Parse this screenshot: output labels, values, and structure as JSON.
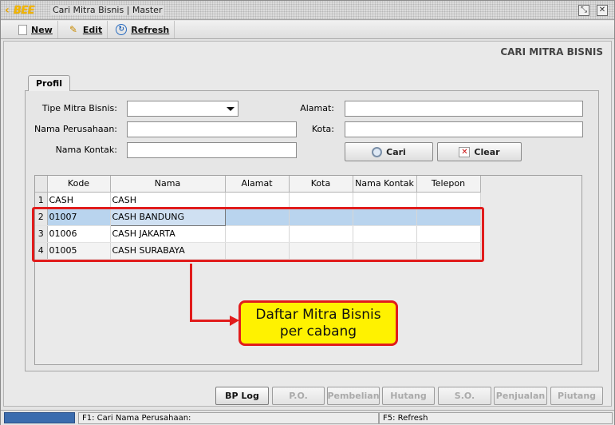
{
  "window": {
    "logo_text": "BEE",
    "title": "Cari Mitra Bisnis | Master",
    "buttons": [
      "restore-icon",
      "close-icon"
    ]
  },
  "toolbar": {
    "new_label": "New",
    "edit_label": "Edit",
    "refresh_label": "Refresh"
  },
  "page_title": "CARI MITRA BISNIS",
  "tab_label": "Profil",
  "form": {
    "tipe_label": "Tipe Mitra Bisnis:",
    "tipe_value": "",
    "nama_perusahaan_label": "Nama Perusahaan:",
    "nama_perusahaan_value": "",
    "nama_kontak_label": "Nama Kontak:",
    "nama_kontak_value": "",
    "alamat_label": "Alamat:",
    "alamat_value": "",
    "kota_label": "Kota:",
    "kota_value": "",
    "cari_label": "Cari",
    "clear_label": "Clear"
  },
  "table": {
    "columns": [
      "Kode",
      "Nama",
      "Alamat",
      "Kota",
      "Nama Kontak",
      "Telepon"
    ],
    "rows": [
      {
        "no": "1",
        "kode": "CASH",
        "nama": "CASH",
        "alamat": "",
        "kota": "",
        "kontak": "",
        "telepon": ""
      },
      {
        "no": "2",
        "kode": "01007",
        "nama": "CASH BANDUNG",
        "alamat": "",
        "kota": "",
        "kontak": "",
        "telepon": ""
      },
      {
        "no": "3",
        "kode": "01006",
        "nama": "CASH JAKARTA",
        "alamat": "",
        "kota": "",
        "kontak": "",
        "telepon": ""
      },
      {
        "no": "4",
        "kode": "01005",
        "nama": "CASH SURABAYA",
        "alamat": "",
        "kota": "",
        "kontak": "",
        "telepon": ""
      }
    ]
  },
  "annotation": {
    "text": "Daftar Mitra Bisnis per cabang",
    "color": "#e11c1c",
    "fill": "#fff200"
  },
  "bottom_buttons": {
    "bp_log": "BP Log",
    "po": "P.O.",
    "pembelian": "Pembelian",
    "hutang": "Hutang",
    "so": "S.O.",
    "penjualan": "Penjualan",
    "piutang": "Piutang"
  },
  "status": {
    "f1": "F1: Cari Nama Perusahaan:",
    "f5": "F5: Refresh"
  }
}
